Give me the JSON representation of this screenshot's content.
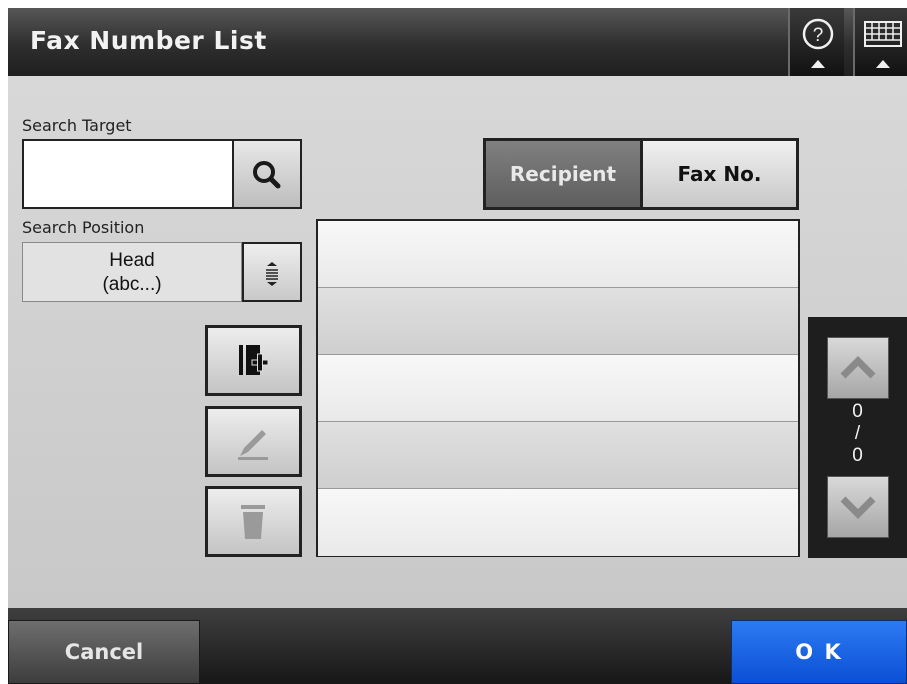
{
  "header": {
    "title": "Fax Number List",
    "help_icon": "help-icon",
    "keyboard_icon": "keyboard-icon"
  },
  "search": {
    "target_label": "Search Target",
    "target_value": "",
    "search_icon": "search-icon",
    "position_label": "Search Position",
    "position_value_line1": "Head",
    "position_value_line2": "(abc...)",
    "position_dropdown_icon": "dropdown-icon"
  },
  "tools": {
    "add_icon": "add-entry-icon",
    "edit_icon": "edit-pencil-icon",
    "delete_icon": "trash-icon"
  },
  "tabs": {
    "recipient": "Recipient",
    "fax_no": "Fax No.",
    "active": "recipient"
  },
  "list": {
    "rows": [
      "",
      "",
      "",
      "",
      ""
    ]
  },
  "pager": {
    "current": "0",
    "separator": "/",
    "total": "0",
    "up_icon": "chevron-up-icon",
    "down_icon": "chevron-down-icon"
  },
  "footer": {
    "cancel_label": "Cancel",
    "ok_label": "O K"
  },
  "colors": {
    "ok_button": "#1a63e6",
    "header": "#2e2e2e",
    "active_tab": "#6e6e6e"
  }
}
